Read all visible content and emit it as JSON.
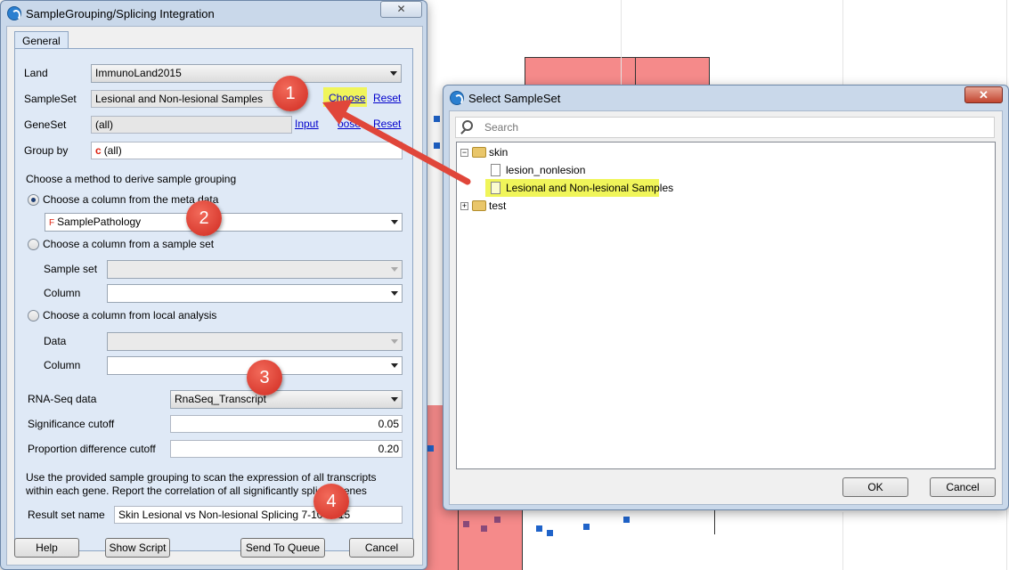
{
  "main_dialog": {
    "title": "SampleGrouping/Splicing Integration",
    "tab": "General",
    "land_label": "Land",
    "land_value": "ImmunoLand2015",
    "sampleset_label": "SampleSet",
    "sampleset_value": "Lesional and Non-lesional Samples",
    "choose_link": "Choose",
    "reset_link": "Reset",
    "geneset_label": "GeneSet",
    "geneset_value": "(all)",
    "input_link": "Input",
    "choose_link_partial": "oose",
    "reset_link_2": "Reset",
    "groupby_label": "Group by",
    "groupby_value": "(all)",
    "method_heading": "Choose a method to derive sample grouping",
    "radio_meta": "Choose a column from the meta data",
    "meta_column_value": "SamplePathology",
    "radio_sampleset": "Choose a column from a sample set",
    "sample_set_label": "Sample set",
    "column_label": "Column",
    "radio_local": "Choose a column from local analysis",
    "data_label": "Data",
    "column_label_2": "Column",
    "rnaseq_label": "RNA-Seq data",
    "rnaseq_value": "RnaSeq_Transcript",
    "significance_label": "Significance cutoff",
    "significance_value": "0.05",
    "proportion_label": "Proportion difference cutoff",
    "proportion_value": "0.20",
    "description": "Use the provided sample grouping to scan the expression of all transcripts within each gene. Report the correlation of all significantly spliced genes",
    "result_label": "Result set name",
    "result_value": "Skin Lesional vs Non-lesional Splicing 7-10-2015",
    "help_button": "Help",
    "show_script_button": "Show Script",
    "send_button": "Send To Queue",
    "cancel_button": "Cancel"
  },
  "select_dialog": {
    "title": "Select SampleSet",
    "search_placeholder": "Search",
    "tree": {
      "folder_skin": "skin",
      "item_1": "lesion_nonlesion",
      "item_2": "Lesional and Non-lesional Samples",
      "folder_test": "test"
    },
    "ok_button": "OK",
    "cancel_button": "Cancel"
  },
  "badges": [
    "1",
    "2",
    "3",
    "4"
  ],
  "colors": {
    "highlight": "#f0f55a",
    "badge": "#d63a2d",
    "arrow": "#e0463a",
    "link": "#0000cc"
  }
}
